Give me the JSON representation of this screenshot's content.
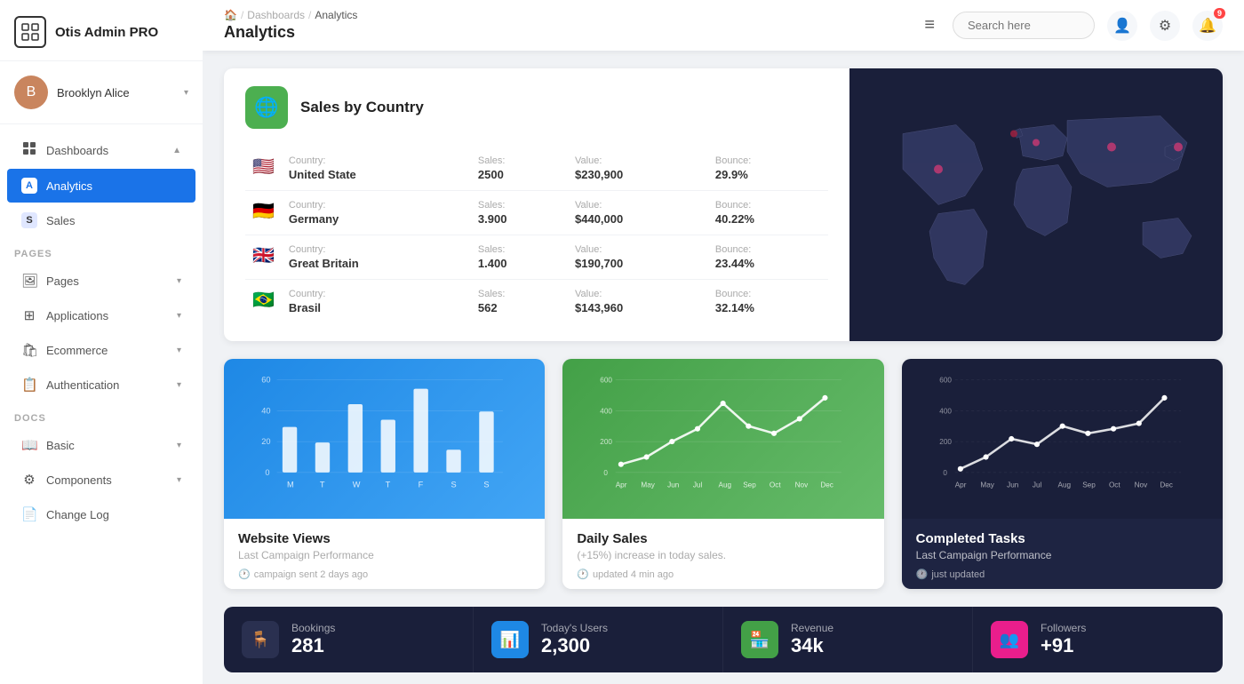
{
  "sidebar": {
    "logo": {
      "title": "Otis Admin PRO",
      "icon": "⊞"
    },
    "user": {
      "name": "Brooklyn Alice",
      "avatar_letter": "B"
    },
    "nav": {
      "dashboards_label": "Dashboards",
      "analytics_label": "Analytics",
      "analytics_badge": "A",
      "sales_label": "Sales",
      "sales_badge": "S"
    },
    "sections": {
      "pages": "PAGES",
      "docs": "DOCS"
    },
    "pages_items": [
      {
        "label": "Pages",
        "icon": "🖼"
      },
      {
        "label": "Applications",
        "icon": "⊞"
      },
      {
        "label": "Ecommerce",
        "icon": "🛍"
      },
      {
        "label": "Authentication",
        "icon": "📋"
      }
    ],
    "docs_items": [
      {
        "label": "Basic",
        "icon": "📖"
      },
      {
        "label": "Components",
        "icon": "⚙"
      },
      {
        "label": "Change Log",
        "icon": "📄"
      }
    ]
  },
  "header": {
    "breadcrumb": [
      "Dashboards",
      "Analytics"
    ],
    "page_title": "Analytics",
    "search_placeholder": "Search here",
    "notif_count": "9",
    "hamburger": "≡"
  },
  "sales_by_country": {
    "title": "Sales by Country",
    "rows": [
      {
        "flag": "🇺🇸",
        "country": "United State",
        "sales": "2500",
        "value": "$230,900",
        "bounce": "29.9%"
      },
      {
        "flag": "🇩🇪",
        "country": "Germany",
        "sales": "3.900",
        "value": "$440,000",
        "bounce": "40.22%"
      },
      {
        "flag": "🇬🇧",
        "country": "Great Britain",
        "sales": "1.400",
        "value": "$190,700",
        "bounce": "23.44%"
      },
      {
        "flag": "🇧🇷",
        "country": "Brasil",
        "sales": "562",
        "value": "$143,960",
        "bounce": "32.14%"
      }
    ],
    "col_headers": {
      "country": "Country:",
      "sales": "Sales:",
      "value": "Value:",
      "bounce": "Bounce:"
    }
  },
  "charts": {
    "website_views": {
      "title": "Website Views",
      "subtitle": "Last Campaign Performance",
      "time_label": "campaign sent 2 days ago",
      "x_labels": [
        "M",
        "T",
        "W",
        "T",
        "F",
        "S",
        "S"
      ],
      "values": [
        30,
        20,
        45,
        35,
        55,
        15,
        40
      ],
      "y_max": 60,
      "y_labels": [
        "60",
        "40",
        "20",
        "0"
      ],
      "color": "blue"
    },
    "daily_sales": {
      "title": "Daily Sales",
      "subtitle": "(+15%) increase in today sales.",
      "time_label": "updated 4 min ago",
      "x_labels": [
        "Apr",
        "May",
        "Jun",
        "Jul",
        "Aug",
        "Sep",
        "Oct",
        "Nov",
        "Dec"
      ],
      "values": [
        50,
        100,
        200,
        280,
        450,
        300,
        250,
        350,
        480
      ],
      "y_max": 600,
      "y_labels": [
        "600",
        "400",
        "200",
        "0"
      ],
      "color": "green"
    },
    "completed_tasks": {
      "title": "Completed Tasks",
      "subtitle": "Last Campaign Performance",
      "time_label": "just updated",
      "x_labels": [
        "Apr",
        "May",
        "Jun",
        "Jul",
        "Aug",
        "Sep",
        "Oct",
        "Nov",
        "Dec"
      ],
      "values": [
        20,
        100,
        220,
        180,
        300,
        250,
        280,
        320,
        480
      ],
      "y_max": 600,
      "y_labels": [
        "600",
        "400",
        "200",
        "0"
      ],
      "color": "dark"
    }
  },
  "stats": [
    {
      "label": "Bookings",
      "value": "281",
      "icon": "🪑",
      "bg": "dark-bg"
    },
    {
      "label": "Today's Users",
      "value": "2,300",
      "icon": "📊",
      "bg": "blue-bg"
    },
    {
      "label": "Revenue",
      "value": "34k",
      "icon": "🏪",
      "bg": "green-bg"
    },
    {
      "label": "Followers",
      "value": "+91",
      "icon": "👥",
      "bg": "pink-bg"
    }
  ]
}
